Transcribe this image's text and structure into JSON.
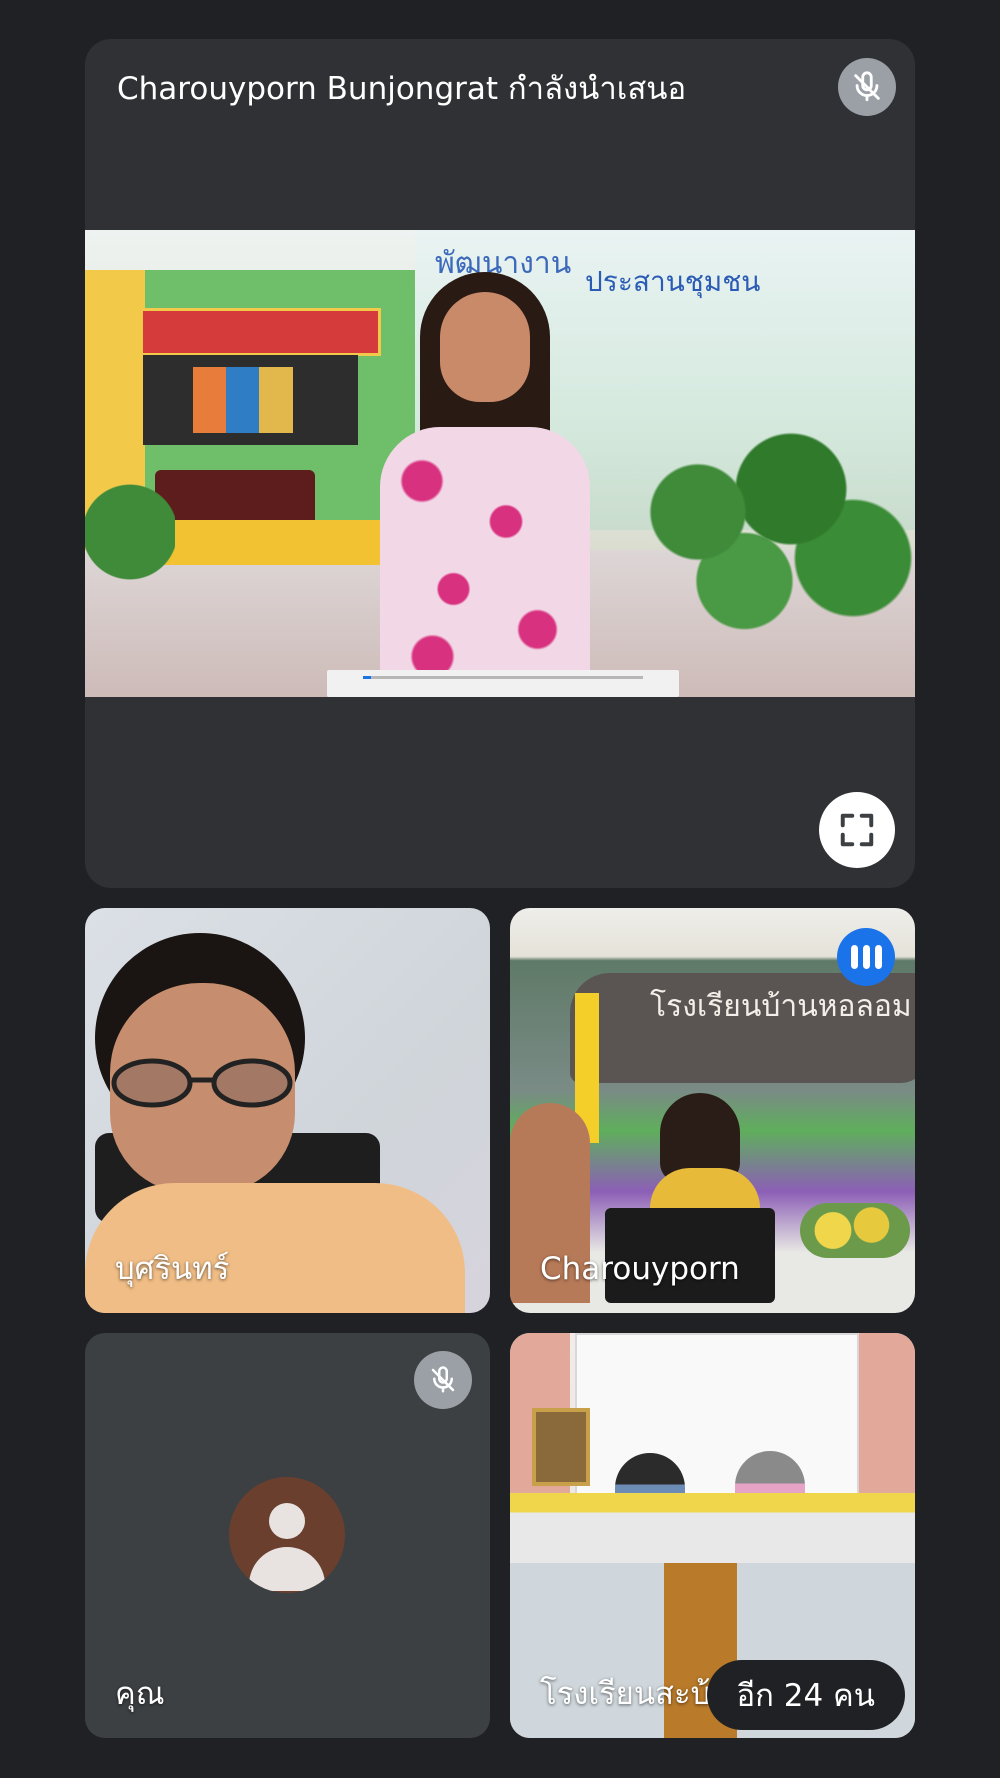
{
  "presentation": {
    "title": "Charouyporn Bunjongrat กำลังนำเสนอ",
    "shared_video_text_1": "พัฒนางาน",
    "shared_video_text_2": "ประสานชุมชน",
    "playback_progress": 0.03
  },
  "participants": [
    {
      "name": "บุศรินทร์",
      "speaking": false
    },
    {
      "name": "Charouyporn",
      "speaking": true,
      "background_text": "โรงเรียนบ้านหอลอม"
    },
    {
      "name": "คุณ",
      "muted": true,
      "avatar": "person-icon"
    },
    {
      "name": "โรงเรียนสะบ้า"
    }
  ],
  "more_participants_label": "อีก 24 คน",
  "colors": {
    "background": "#202124",
    "tile": "#303134",
    "speaking_accent": "#1a73e8",
    "mic_off_bg": "#9aa0a6",
    "avatar_bg": "#6b3f2e"
  }
}
